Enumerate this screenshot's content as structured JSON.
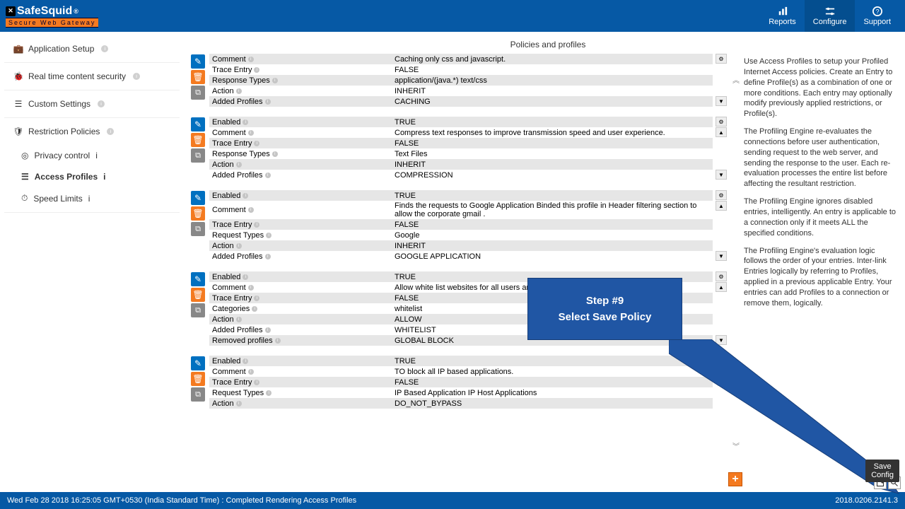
{
  "header": {
    "logo_main": "SafeSquid",
    "logo_reg": "®",
    "logo_sub": "Secure Web Gateway",
    "actions": [
      {
        "label": "Reports",
        "icon": "chart"
      },
      {
        "label": "Configure",
        "icon": "sliders",
        "active": true
      },
      {
        "label": "Support",
        "icon": "help"
      }
    ]
  },
  "sidebar": {
    "groups": [
      {
        "label": "Application Setup",
        "icon": "briefcase",
        "info": true
      },
      {
        "label": "Real time content security",
        "icon": "bug",
        "info": true
      },
      {
        "label": "Custom Settings",
        "icon": "sliders",
        "info": true
      }
    ],
    "restriction": {
      "label": "Restriction Policies",
      "icon": "shield",
      "info": true
    },
    "subs": [
      {
        "label": "Privacy control",
        "icon": "eye",
        "info": true
      },
      {
        "label": "Access Profiles",
        "icon": "list",
        "info": true,
        "active": true
      },
      {
        "label": "Speed Limits",
        "icon": "speed",
        "info": true
      }
    ]
  },
  "main": {
    "title": "Policies and profiles"
  },
  "help": {
    "p1": "Use Access Profiles to setup your Profiled Internet Access policies. Create an Entry to define Profile(s) as a combination of one or more conditions. Each entry may optionally modify previously applied restrictions, or Profile(s).",
    "p2": "The Profiling Engine re-evaluates the connections before user authentication, sending request to the web server, and sending the response to the user. Each re-evaluation processes the entire list before affecting the resultant restriction.",
    "p3": "The Profiling Engine ignores disabled entries, intelligently. An entry is applicable to a connection only if it meets ALL the specified conditions.",
    "p4": "The Profiling Engine's evaluation logic follows the order of your entries. Inter-link Entries logically by referring to Profiles, applied in a previous applicable Entry. Your entries can add Profiles to a connection or remove them, logically."
  },
  "entries": [
    {
      "rows": [
        {
          "k": "Comment",
          "v": "Caching only css and javascript."
        },
        {
          "k": "Trace Entry",
          "v": "FALSE"
        },
        {
          "k": "Response Types",
          "v": "application/(java.*)  text/css"
        },
        {
          "k": "Action",
          "v": "INHERIT"
        },
        {
          "k": "Added Profiles",
          "v": "CACHING"
        }
      ],
      "partial_top": true
    },
    {
      "rows": [
        {
          "k": "Enabled",
          "v": "TRUE"
        },
        {
          "k": "Comment",
          "v": "Compress text responses to improve transmission speed and user experience."
        },
        {
          "k": "Trace Entry",
          "v": "FALSE"
        },
        {
          "k": "Response Types",
          "v": "Text Files"
        },
        {
          "k": "Action",
          "v": "INHERIT"
        },
        {
          "k": "Added Profiles",
          "v": "COMPRESSION"
        }
      ]
    },
    {
      "rows": [
        {
          "k": "Enabled",
          "v": "TRUE"
        },
        {
          "k": "Comment",
          "v": "Finds the requests to Google Application Binded this profile in Header filtering section to allow the corporate gmail ."
        },
        {
          "k": "Trace Entry",
          "v": "FALSE"
        },
        {
          "k": "Request Types",
          "v": "Google"
        },
        {
          "k": "Action",
          "v": "INHERIT"
        },
        {
          "k": "Added Profiles",
          "v": "GOOGLE APPLICATION"
        }
      ]
    },
    {
      "rows": [
        {
          "k": "Enabled",
          "v": "TRUE"
        },
        {
          "k": "Comment",
          "v": "Allow white list websites for all users and Categorize web-sites to Create and add w"
        },
        {
          "k": "Trace Entry",
          "v": "FALSE"
        },
        {
          "k": "Categories",
          "v": "whitelist"
        },
        {
          "k": "Action",
          "v": "ALLOW"
        },
        {
          "k": "Added Profiles",
          "v": "WHITELIST"
        },
        {
          "k": "Removed profiles",
          "v": "GLOBAL BLOCK"
        }
      ]
    },
    {
      "rows": [
        {
          "k": "Enabled",
          "v": "TRUE"
        },
        {
          "k": "Comment",
          "v": "TO block all IP based applications."
        },
        {
          "k": "Trace Entry",
          "v": "FALSE"
        },
        {
          "k": "Request Types",
          "v": "IP Based Application  IP Host Applications"
        },
        {
          "k": "Action",
          "v": "DO_NOT_BYPASS"
        }
      ],
      "partial_bottom": true
    }
  ],
  "callout": {
    "line1": "Step #9",
    "line2": "Select Save Policy"
  },
  "tooltip": "Save\nConfig",
  "status": {
    "left": "Wed Feb 28 2018 16:25:05 GMT+0530 (India Standard Time) : Completed Rendering Access Profiles",
    "right": "2018.0206.2141.3"
  }
}
